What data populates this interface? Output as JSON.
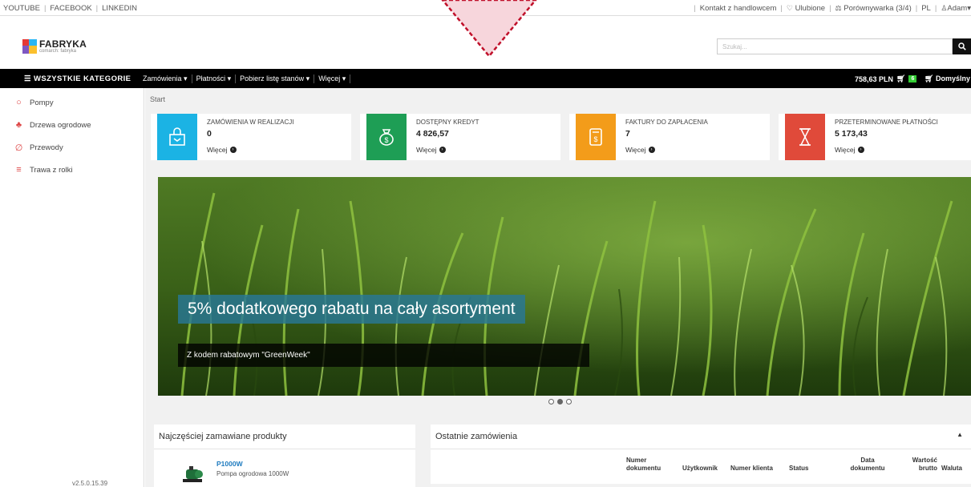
{
  "topbar": {
    "left_links": [
      "YOUTUBE",
      "FACEBOOK",
      "LINKEDIN"
    ],
    "contact": "Kontakt z handlowcem",
    "favorites": "Ulubione",
    "compare": "Porównywarka (3/4)",
    "language": "PL",
    "user": "Adam"
  },
  "logo": {
    "name": "FABRYKA",
    "tagline": "comarch: fabryka"
  },
  "search": {
    "placeholder": "Szukaj..."
  },
  "nav": {
    "all_categories": "WSZYSTKIE KATEGORIE",
    "menu": [
      "Zamówienia",
      "Płatności",
      "Pobierz listę stanów",
      "Więcej"
    ],
    "cart_total": "758,63 PLN",
    "cart_count": "6",
    "default_cart": "Domyślny"
  },
  "sidebar": {
    "items": [
      {
        "label": "Pompy",
        "icon": "drop-icon"
      },
      {
        "label": "Drzewa ogrodowe",
        "icon": "tree-icon"
      },
      {
        "label": "Przewody",
        "icon": "hose-icon"
      },
      {
        "label": "Trawa z rolki",
        "icon": "grass-icon"
      }
    ],
    "version": "v2.5.0.15.39"
  },
  "breadcrumb": "Start",
  "tiles": [
    {
      "title": "ZAMÓWIENIA W REALIZACJI",
      "value": "0",
      "more": "Więcej",
      "color": "#1bb3e4",
      "icon": "shopping-bag-icon"
    },
    {
      "title": "DOSTĘPNY KREDYT",
      "value": "4 826,57",
      "more": "Więcej",
      "color": "#1e9e55",
      "icon": "money-bag-icon"
    },
    {
      "title": "FAKTURY DO ZAPŁACENIA",
      "value": "7",
      "more": "Więcej",
      "color": "#f39c1a",
      "icon": "invoice-icon"
    },
    {
      "title": "PRZETERMINOWANE PŁATNOŚCI",
      "value": "5 173,43",
      "more": "Więcej",
      "color": "#e04a3a",
      "icon": "hourglass-icon"
    }
  ],
  "banner": {
    "headline": "5% dodatkowego rabatu na cały asortyment",
    "subtext": "Z kodem rabatowym \"GreenWeek\"",
    "slides": 3,
    "active_slide": 2
  },
  "popular": {
    "title": "Najczęściej zamawiane produkty",
    "items": [
      {
        "code": "P1000W",
        "name": "Pompa ogrodowa 1000W"
      }
    ]
  },
  "orders": {
    "title": "Ostatnie zamówienia",
    "columns": [
      "Numer dokumentu",
      "Użytkownik",
      "Numer klienta",
      "Status",
      "Data dokumentu",
      "Wartość brutto",
      "Waluta"
    ]
  },
  "colors": {
    "accent_blue": "#1e7bbf",
    "nav_bg": "#000000",
    "overlay": "#c0102a"
  }
}
